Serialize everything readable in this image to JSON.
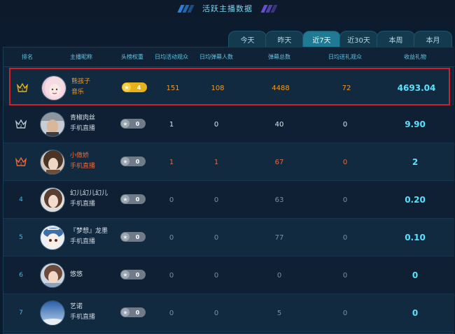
{
  "header": {
    "title": "活跃主播数据"
  },
  "tabs": [
    "今天",
    "昨天",
    "近7天",
    "近30天",
    "本周",
    "本月"
  ],
  "active_tab": "近7天",
  "columns": [
    "排名",
    "主播昵称",
    "头榜权重",
    "日均活动观众",
    "日均弹幕人数",
    "弹幕总数",
    "日均送礼观众",
    "收益礼物"
  ],
  "rows": [
    {
      "rank": "1",
      "name": "熊孩子",
      "sub": "音乐",
      "weight": "4",
      "avg_viewers": "151",
      "avg_danmaku_users": "108",
      "total_danmaku": "4488",
      "avg_gifters": "72",
      "gift": "4693.04"
    },
    {
      "rank": "2",
      "name": "青椒肉丝",
      "sub": "手机直播",
      "weight": "0",
      "avg_viewers": "1",
      "avg_danmaku_users": "0",
      "total_danmaku": "40",
      "avg_gifters": "0",
      "gift": "9.90"
    },
    {
      "rank": "3",
      "name": "小傲娇",
      "sub": "手机直播",
      "weight": "0",
      "avg_viewers": "1",
      "avg_danmaku_users": "1",
      "total_danmaku": "67",
      "avg_gifters": "0",
      "gift": "2"
    },
    {
      "rank": "4",
      "name": "幻儿幻儿幻儿",
      "sub": "手机直播",
      "weight": "0",
      "avg_viewers": "0",
      "avg_danmaku_users": "0",
      "total_danmaku": "63",
      "avg_gifters": "0",
      "gift": "0.20"
    },
    {
      "rank": "5",
      "name": "『梦想』龙墨",
      "sub": "手机直播",
      "weight": "0",
      "avg_viewers": "0",
      "avg_danmaku_users": "0",
      "total_danmaku": "77",
      "avg_gifters": "0",
      "gift": "0.10"
    },
    {
      "rank": "6",
      "name": "悠悠",
      "sub": "",
      "weight": "0",
      "avg_viewers": "0",
      "avg_danmaku_users": "0",
      "total_danmaku": "0",
      "avg_gifters": "0",
      "gift": "0"
    },
    {
      "rank": "7",
      "name": "艺诺",
      "sub": "手机直播",
      "weight": "0",
      "avg_viewers": "0",
      "avg_danmaku_users": "0",
      "total_danmaku": "5",
      "avg_gifters": "0",
      "gift": "0"
    }
  ],
  "colors": {
    "accent": "#59e2ff",
    "gold": "#e6b21a",
    "orange": "#f19a2a",
    "red_highlight": "#d0202a"
  }
}
